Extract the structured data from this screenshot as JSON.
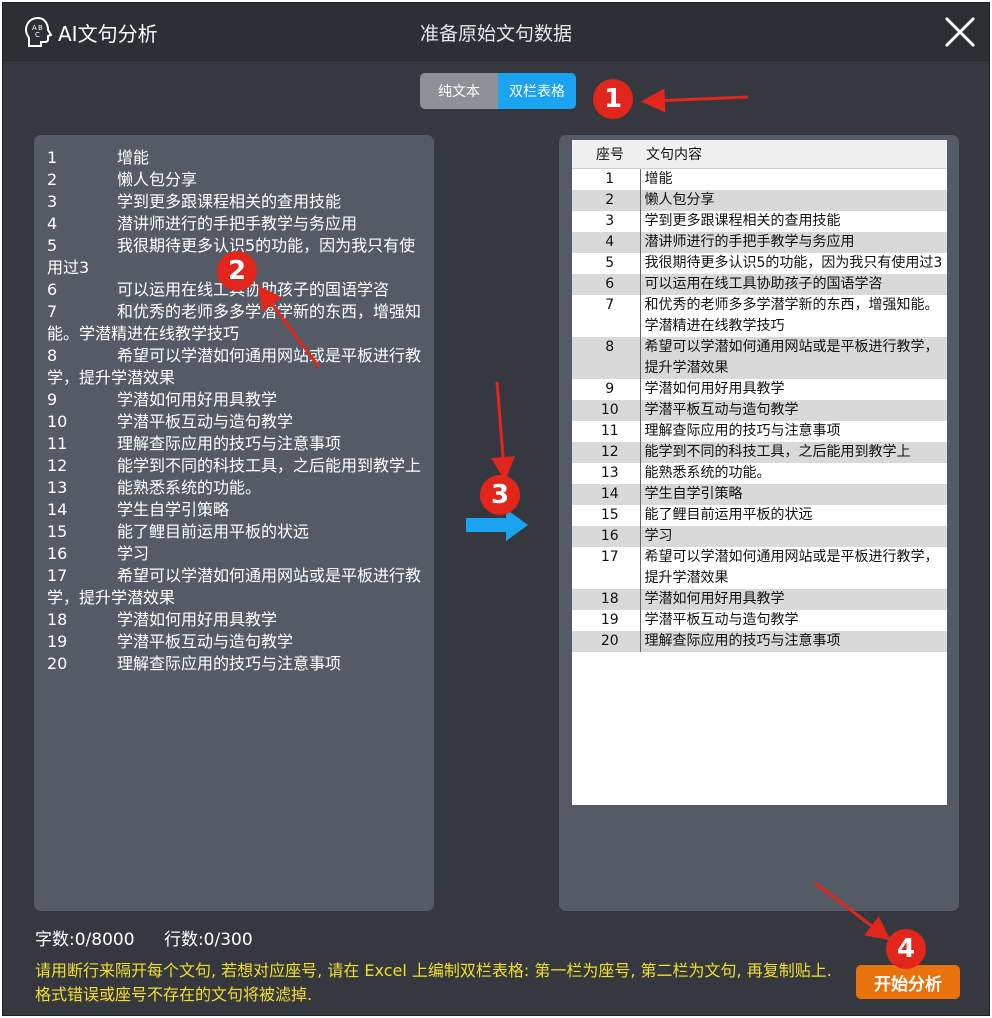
{
  "app": {
    "name": "AI文句分析",
    "window_title": "准备原始文句数据"
  },
  "toggle": {
    "plain_label": "纯文本",
    "table_label": "双栏表格",
    "selected": "双栏表格"
  },
  "left_items": [
    {
      "num": "1",
      "text": "增能"
    },
    {
      "num": "2",
      "text": "懒人包分享"
    },
    {
      "num": "3",
      "text": "学到更多跟课程相关的查用技能"
    },
    {
      "num": "4",
      "text": "潜讲师进行的手把手教学与务应用"
    },
    {
      "num": "5",
      "text": "我很期待更多认识5的功能，因为我只有使用过3"
    },
    {
      "num": "6",
      "text": "可以运用在线工具协助孩子的国语学咨"
    },
    {
      "num": "7",
      "text": "和优秀的老师多多学潜学新的东西，增强知能。学潜精进在线教学技巧"
    },
    {
      "num": "8",
      "text": "希望可以学潜如何通用网站或是平板进行教学，提升学潜效果"
    },
    {
      "num": "9",
      "text": "学潜如何用好用具教学"
    },
    {
      "num": "10",
      "text": "学潜平板互动与造句教学"
    },
    {
      "num": "11",
      "text": "理解查际应用的技巧与注意事项"
    },
    {
      "num": "12",
      "text": "能学到不同的科技工具，之后能用到教学上"
    },
    {
      "num": "13",
      "text": "能熟悉系统的功能。"
    },
    {
      "num": "14",
      "text": "学生自学引策略"
    },
    {
      "num": "15",
      "text": "能了鲤目前运用平板的状远"
    },
    {
      "num": "16",
      "text": "学习"
    },
    {
      "num": "17",
      "text": "希望可以学潜如何通用网站或是平板进行教学，提升学潜效果"
    },
    {
      "num": "18",
      "text": "学潜如何用好用具教学"
    },
    {
      "num": "19",
      "text": "学潜平板互动与造句教学"
    },
    {
      "num": "20",
      "text": "理解查际应用的技巧与注意事项"
    }
  ],
  "grid": {
    "col1": "座号",
    "col2": "文句内容",
    "rows": [
      {
        "num": "1",
        "text": "增能"
      },
      {
        "num": "2",
        "text": "懒人包分享"
      },
      {
        "num": "3",
        "text": "学到更多跟课程相关的查用技能"
      },
      {
        "num": "4",
        "text": "潜讲师进行的手把手教学与务应用"
      },
      {
        "num": "5",
        "text": "我很期待更多认识5的功能，因为我只有使用过3"
      },
      {
        "num": "6",
        "text": "可以运用在线工具协助孩子的国语学咨"
      },
      {
        "num": "7",
        "text": "和优秀的老师多多学潜学新的东西，增强知能。学潜精进在线教学技巧"
      },
      {
        "num": "8",
        "text": "希望可以学潜如何通用网站或是平板进行教学，提升学潜效果"
      },
      {
        "num": "9",
        "text": "学潜如何用好用具教学"
      },
      {
        "num": "10",
        "text": "学潜平板互动与造句教学"
      },
      {
        "num": "11",
        "text": "理解查际应用的技巧与注意事项"
      },
      {
        "num": "12",
        "text": "能学到不同的科技工具，之后能用到教学上"
      },
      {
        "num": "13",
        "text": "能熟悉系统的功能。"
      },
      {
        "num": "14",
        "text": "学生自学引策略"
      },
      {
        "num": "15",
        "text": "能了鲤目前运用平板的状远"
      },
      {
        "num": "16",
        "text": "学习"
      },
      {
        "num": "17",
        "text": "希望可以学潜如何通用网站或是平板进行教学，提升学潜效果"
      },
      {
        "num": "18",
        "text": "学潜如何用好用具教学"
      },
      {
        "num": "19",
        "text": "学潜平板互动与造句教学"
      },
      {
        "num": "20",
        "text": "理解查际应用的技巧与注意事项"
      }
    ]
  },
  "counts": {
    "chars": "字数:0/8000",
    "lines": "行数:0/300"
  },
  "hint": "请用断行来隔开每个文句, 若想对应座号, 请在 Excel 上编制双栏表格: 第一栏为座号, 第二栏为文句, 再复制贴上. 格式错误或座号不存在的文句将被滤掉.",
  "start_button": "开始分析",
  "badges": [
    "1",
    "2",
    "3",
    "4"
  ],
  "colors": {
    "accent": "#1aa3f0",
    "start": "#e8730c",
    "hint": "#f3df2b",
    "badge": "#e2261c"
  }
}
